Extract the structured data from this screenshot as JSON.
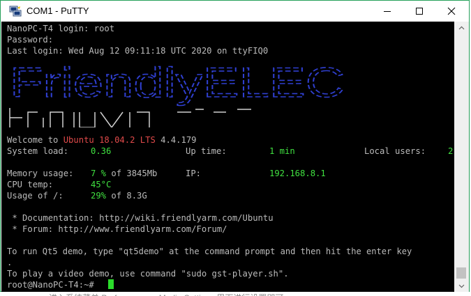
{
  "window": {
    "title": "COM1 - PuTTY"
  },
  "colors": {
    "accent_border": "#25a05a",
    "ubuntu_red": "#e04a4a",
    "value_green": "#40e040",
    "cursor": "#2bdc2b"
  },
  "terminal": {
    "login_line": "NanoPC-T4 login: root",
    "password_line": "Password:",
    "last_login_line": "Last login: Wed Aug 12 09:11:18 UTC 2020 on ttyFIQ0",
    "banner_text": "FriendlyELEC",
    "welcome_prefix": "Welcome to ",
    "welcome_os": "Ubuntu 18.04.2 LTS",
    "welcome_kernel": " 4.4.179",
    "system_load_label": "System load:",
    "system_load_value": "0.36",
    "uptime_label": "Up time:",
    "uptime_value": "1 min",
    "local_users_label": "Local users:",
    "local_users_value": "2",
    "memory_label": "Memory usage:",
    "memory_percent": "7 %",
    "memory_rest": " of 3845Mb",
    "ip_label": "IP:",
    "ip_value": "192.168.8.1",
    "cpu_label": "CPU temp:",
    "cpu_value": "45°C",
    "usage_label": "Usage of /:",
    "usage_percent": "29%",
    "usage_rest": " of 8.3G",
    "doc_line": " * Documentation: http://wiki.friendlyarm.com/Ubuntu",
    "forum_line": " * Forum: http://www.friendlyarm.com/Forum/",
    "qt_line": "To run Qt5 demo, type \"qt5demo\" at the command prompt and then hit the enter key",
    "dot_line": ".",
    "video_line": "To play a video demo, use command \"sudo gst-player.sh\".",
    "prompt": "root@NanoPC-T4:~#"
  },
  "icons": {
    "app": "putty-icon",
    "minimize": "minimize-icon",
    "maximize": "maximize-icon",
    "close": "close-icon",
    "scroll_up": "scroll-up-icon",
    "scroll_down": "scroll-down-icon"
  },
  "background_text": "进入系统菜单 Preferences -> Media Settings 里面进行设置即可"
}
